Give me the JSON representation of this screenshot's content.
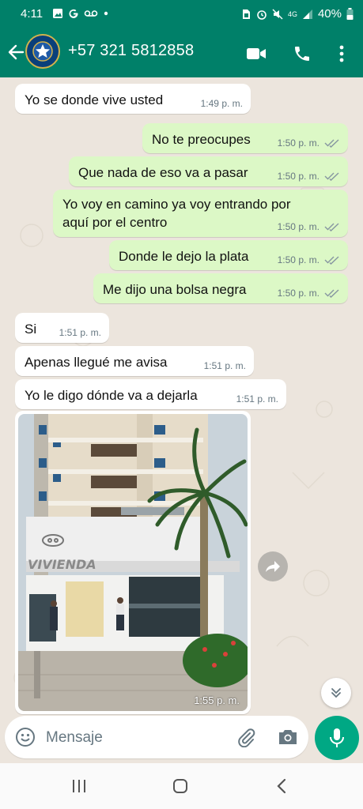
{
  "status_bar": {
    "time": "4:11",
    "network": "4G",
    "battery": "40%"
  },
  "header": {
    "contact": "+57 321 5812858",
    "icons": [
      "back-arrow-icon",
      "video-call-icon",
      "phone-icon",
      "more-vert-icon"
    ]
  },
  "messages": [
    {
      "dir": "in",
      "text": "Yo se donde vive usted",
      "time": "1:49 p. m."
    },
    {
      "dir": "out",
      "text": "No te preocupes",
      "time": "1:50 p. m.",
      "read": true
    },
    {
      "dir": "out",
      "text": "Que nada de eso va a pasar",
      "time": "1:50 p. m.",
      "read": true
    },
    {
      "dir": "out",
      "line1": "Yo voy en camino ya voy entrando por",
      "line2": "aquí por el centro",
      "time": "1:50 p. m.",
      "read": true
    },
    {
      "dir": "out",
      "text": "Donde le dejo la plata",
      "time": "1:50 p. m.",
      "read": true
    },
    {
      "dir": "out",
      "text": "Me dijo una bolsa negra",
      "time": "1:50 p. m.",
      "read": true
    },
    {
      "dir": "in",
      "text": "Si",
      "time": "1:51 p. m."
    },
    {
      "dir": "in",
      "text": "Apenas llegué me avisa",
      "time": "1:51 p. m."
    },
    {
      "dir": "in",
      "text": "Yo le digo dónde va a dejarla",
      "time": "1:51 p. m."
    }
  ],
  "photo": {
    "sign": "VIVIENDA",
    "time": "1:55 p. m."
  },
  "composer": {
    "placeholder": "Mensaje"
  },
  "colors": {
    "header": "#008069",
    "outgoing": "#DCF8C6",
    "incoming": "#FFFFFF",
    "wallpaper": "#ECE5DD",
    "mic": "#00A884",
    "read_ticks": "#8696A0"
  }
}
